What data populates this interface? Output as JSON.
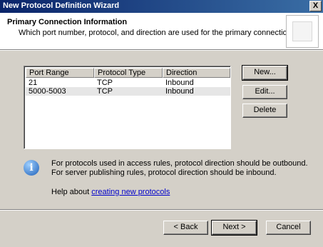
{
  "window": {
    "title": "New Protocol Definition Wizard",
    "close_glyph": "X"
  },
  "header": {
    "heading": "Primary Connection Information",
    "subheading": "Which port number, protocol, and direction are used for the primary connection?"
  },
  "table": {
    "columns": [
      "Port Range",
      "Protocol Type",
      "Direction"
    ],
    "rows": [
      [
        "21",
        "TCP",
        "Inbound"
      ],
      [
        "5000-5003",
        "TCP",
        "Inbound"
      ]
    ]
  },
  "side_buttons": {
    "new_label": "New...",
    "edit_label": "Edit...",
    "delete_label": "Delete"
  },
  "info": {
    "line1": "For protocols used in access rules, protocol direction should be outbound.",
    "line2": "For server publishing rules, protocol direction should be inbound.",
    "icon": "info-icon",
    "icon_glyph": "i"
  },
  "help": {
    "prefix": "Help about ",
    "link": "creating new protocols"
  },
  "footer": {
    "back_label": "< Back",
    "next_label": "Next >",
    "cancel_label": "Cancel"
  }
}
